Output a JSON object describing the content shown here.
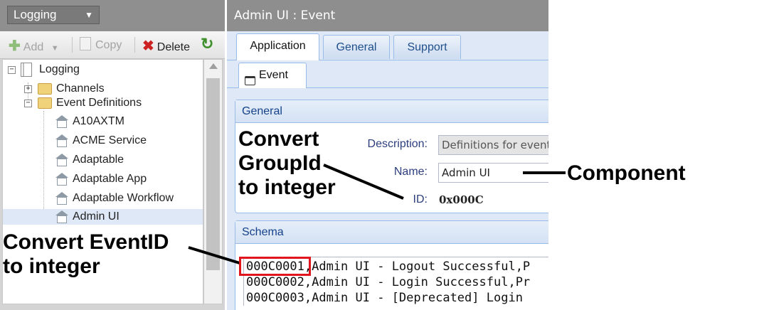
{
  "left_pane": {
    "module_select": "Logging",
    "toolbar": {
      "add": "Add",
      "copy": "Copy",
      "delete": "Delete"
    },
    "tree": {
      "root": "Logging",
      "channels": "Channels",
      "event_definitions": "Event Definitions",
      "items": [
        "A10AXTM",
        "ACME Service",
        "Adaptable",
        "Adaptable App",
        "Adaptable Workflow",
        "Admin UI"
      ],
      "selected": "Admin UI"
    }
  },
  "right_pane": {
    "title": "Admin UI : Event",
    "tabs": [
      "Application",
      "General",
      "Support"
    ],
    "active_tab": "Application",
    "subtab": "Event",
    "general_group": {
      "header": "General",
      "description_label": "Description:",
      "description_value": "Definitions for events",
      "name_label": "Name:",
      "name_value": "Admin UI",
      "id_label": "ID:",
      "id_value": "0x000C"
    },
    "schema_group": {
      "header": "Schema",
      "lines": [
        "000C0001,Admin UI - Logout Successful,P",
        "000C0002,Admin UI - Login Successful,Pr",
        "000C0003,Admin UI - [Deprecated] Login"
      ]
    }
  },
  "annotations": {
    "convert_groupid": [
      "Convert",
      "GroupId",
      "to integer"
    ],
    "component": "Component",
    "convert_eventid": [
      "Convert EventID",
      "to integer"
    ],
    "highlight_color": "#e0161e"
  }
}
